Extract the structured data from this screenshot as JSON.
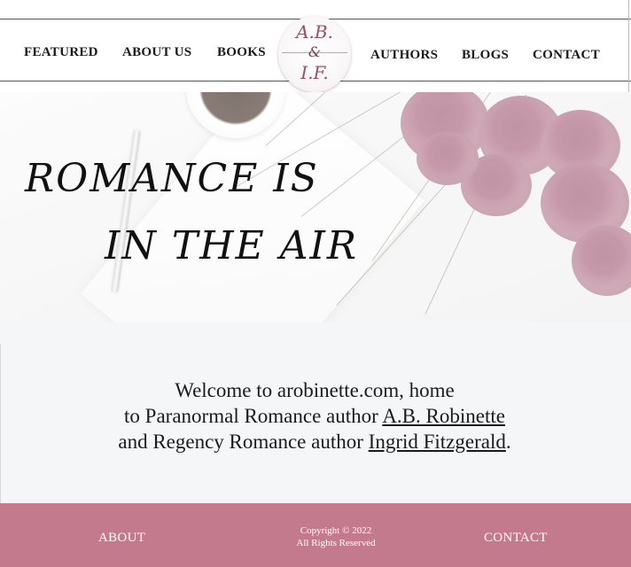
{
  "nav": {
    "left": [
      "FEATURED",
      "ABOUT US",
      "BOOKS"
    ],
    "right": [
      "AUTHORS",
      "BLOGS",
      "CONTACT"
    ]
  },
  "logo": {
    "line1": "A.B.",
    "line2": "&",
    "line3": "I.F."
  },
  "hero": {
    "line1": "ROMANCE IS",
    "line2": "IN THE AIR"
  },
  "welcome": {
    "line1": "Welcome to arobinette.com, home",
    "line2_prefix": "to Paranormal Romance author ",
    "author1": "A.B. Robinette",
    "line3_prefix": "and Regency Romance author ",
    "author2": "Ingrid Fitzgerald",
    "line3_suffix": "."
  },
  "footer": {
    "about": "ABOUT",
    "copyright_line1": "Copyright © 2022",
    "copyright_line2": "All Rights Reserved",
    "contact": "CONTACT"
  },
  "colors": {
    "footer_bg": "#c47a8d",
    "logo_accent": "#9b4d68"
  }
}
